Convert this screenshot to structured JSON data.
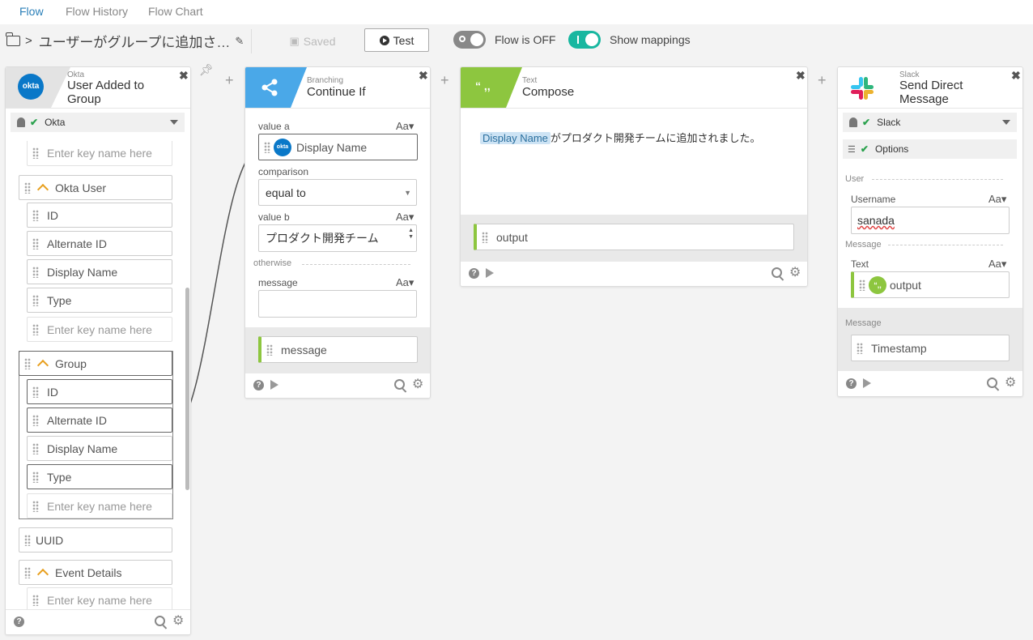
{
  "tabs": [
    "Flow",
    "Flow History",
    "Flow Chart"
  ],
  "header": {
    "title": "ユーザーがグループに追加さ…",
    "saved_label": "Saved",
    "test_label": "Test",
    "flow_toggle_label": "Flow is OFF",
    "mappings_label": "Show mappings"
  },
  "okta_card": {
    "sub": "Okta",
    "title": "User Added to Group",
    "connection": "Okta",
    "top_placeholder": "Enter key name here",
    "okta_user": "Okta User",
    "user_fields": [
      "ID",
      "Alternate ID",
      "Display Name",
      "Type"
    ],
    "user_placeholder": "Enter key name here",
    "group": "Group",
    "group_fields": [
      "ID",
      "Alternate ID",
      "Display Name",
      "Type"
    ],
    "group_placeholder": "Enter key name here",
    "uuid": "UUID",
    "event_details": "Event Details",
    "event_placeholder": "Enter key name here",
    "logo": "okta"
  },
  "branch_card": {
    "sub": "Branching",
    "title": "Continue If",
    "value_a_label": "value a",
    "value_a": "Display Name",
    "comparison_label": "comparison",
    "comparison": "equal to",
    "value_b_label": "value b",
    "value_b": "プロダクト開発チーム",
    "otherwise": "otherwise",
    "message_label": "message",
    "message_output": "message",
    "aa": "Aa"
  },
  "compose_card": {
    "sub": "Text",
    "title": "Compose",
    "pill": "Display Name",
    "text": "がプロダクト開発チームに追加されました。",
    "output": "output",
    "icon_glyph": "“ ,,"
  },
  "slack_card": {
    "sub": "Slack",
    "title": "Send Direct Message",
    "connection": "Slack",
    "options": "Options",
    "user_section": "User",
    "username_label": "Username",
    "username": "sanada",
    "message_section": "Message",
    "text_label": "Text",
    "text_value": "output",
    "message_section2": "Message",
    "timestamp": "Timestamp",
    "aa": "Aa"
  },
  "colors": {
    "accent": "#2a7fb8",
    "toggle_on": "#18b7a0",
    "branch": "#4aa8e8",
    "compose": "#8dc63f"
  }
}
